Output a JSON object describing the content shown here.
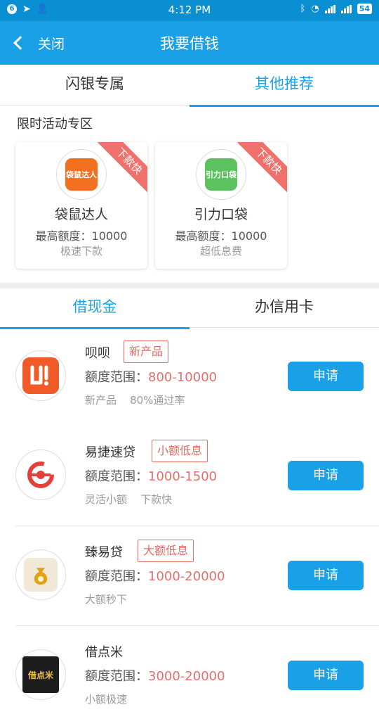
{
  "status_bar": {
    "time": "4:12 PM",
    "notif_count": "6",
    "battery": "54"
  },
  "nav": {
    "back_label": "关闭",
    "title": "我要借钱"
  },
  "top_tabs": [
    "闪银专属",
    "其他推荐"
  ],
  "promo": {
    "section_title": "限时活动专区",
    "cards": [
      {
        "name": "袋鼠达人",
        "limit": "最高额度：10000",
        "tag": "极速下款",
        "ribbon": "下款快",
        "logo_text": "袋鼠达人",
        "logo_color": "#f37021"
      },
      {
        "name": "引力口袋",
        "limit": "最高额度：10000",
        "tag": "超低息费",
        "ribbon": "下款快",
        "logo_text": "引力口袋",
        "logo_color": "#5cc15f"
      }
    ]
  },
  "sub_tabs": [
    "借现金",
    "办信用卡"
  ],
  "loans": [
    {
      "name": "呗呗",
      "badge": "新产品",
      "range_label": "额度范围：",
      "range_value": "800-10000",
      "tags": "新产品    80%通过率",
      "apply": "申请",
      "icon": "beibei-icon"
    },
    {
      "name": "易捷速贷",
      "badge": "小额低息",
      "range_label": "额度范围：",
      "range_value": "1000-1500",
      "tags": "灵活小额    下款快",
      "apply": "申请",
      "icon": "yijie-icon"
    },
    {
      "name": "臻易贷",
      "badge": "大额低息",
      "range_label": "额度范围：",
      "range_value": "1000-20000",
      "tags": "大额秒下",
      "apply": "申请",
      "icon": "zhenyidai-icon"
    },
    {
      "name": "借点米",
      "badge": "",
      "range_label": "额度范围：",
      "range_value": "3000-20000",
      "tags": "小额极速",
      "apply": "申请",
      "icon": "jiedianmi-icon",
      "logo_text": "借点米"
    }
  ],
  "colors": {
    "brand_blue": "#1aa0e6",
    "accent_red": "#e5706b"
  }
}
